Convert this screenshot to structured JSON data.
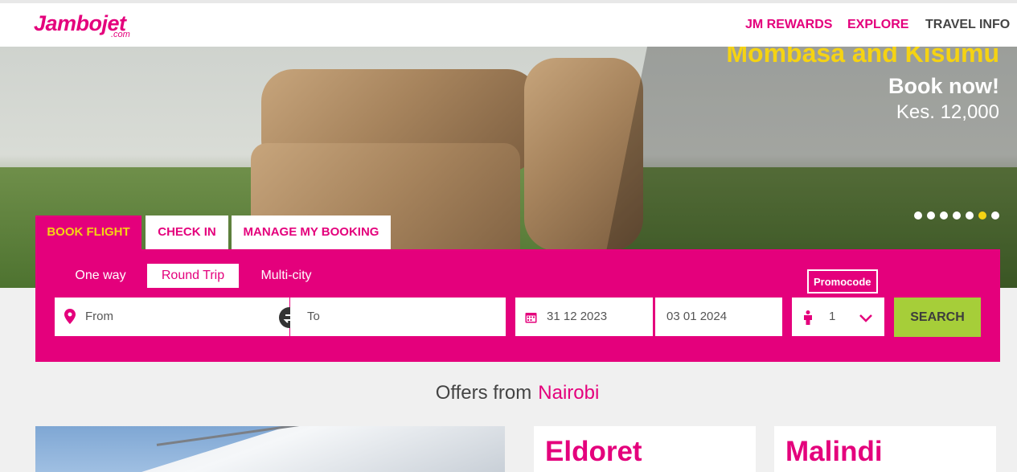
{
  "header": {
    "logo_text": "Jambojet",
    "logo_sub": ".com",
    "nav": [
      {
        "label": "JM REWARDS",
        "color": "#e4007c"
      },
      {
        "label": "EXPLORE",
        "color": "#e4007c"
      },
      {
        "label": "TRAVEL INFO",
        "color": "#444444"
      }
    ]
  },
  "hero": {
    "promo_title": "Mombasa and Kisumu",
    "promo_cta": "Book now!",
    "promo_price": "Kes. 12,000",
    "slide_count": 7,
    "active_slide": 6
  },
  "booking": {
    "tabs": [
      "BOOK FLIGHT",
      "CHECK IN",
      "MANAGE MY BOOKING"
    ],
    "active_tab": 0,
    "trip_types": [
      "One way",
      "Round Trip",
      "Multi-city"
    ],
    "selected_trip": 1,
    "from_placeholder": "From",
    "to_placeholder": "To",
    "depart_date": "31 12 2023",
    "return_date": "03 01 2024",
    "promocode_label": "Promocode",
    "passengers": "1",
    "search_label": "SEARCH"
  },
  "offers": {
    "heading": "Offers from",
    "city": "Nairobi",
    "cards": [
      {
        "title": "Eldoret"
      },
      {
        "title": "Malindi"
      }
    ]
  },
  "colors": {
    "brand": "#e4007c",
    "accent": "#f5d313",
    "search": "#a6ce39"
  },
  "icons": [
    "location-pin-icon",
    "swap-icon",
    "calendar-icon",
    "person-icon",
    "chevron-down-icon"
  ]
}
